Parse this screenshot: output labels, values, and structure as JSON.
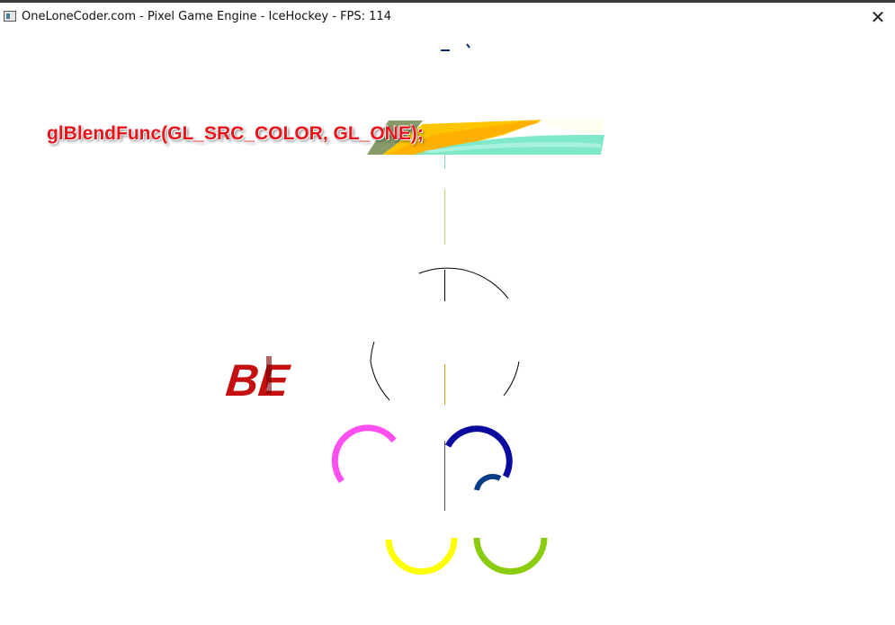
{
  "window": {
    "title": "OneLoneCoder.com - Pixel Game Engine - IceHockey - FPS: 114",
    "close_glyph": "✕",
    "app_icon": "window-app-icon"
  },
  "scene": {
    "blend_label": "glBlendFunc(GL_SRC_COLOR, GL_ONE);",
    "blend_label_color": "#e8141c",
    "logo_partial_text": "BE",
    "logo_color": "#c41010",
    "ring_colors": {
      "magenta": "#ff4ff0",
      "blue": "#0a0a9e",
      "yellow": "#ffff00",
      "green": "#8ccc10",
      "navy": "#0b3d86"
    },
    "banner_colors": [
      "#7a8f5a",
      "#ffb000",
      "#7fe8c8"
    ]
  }
}
